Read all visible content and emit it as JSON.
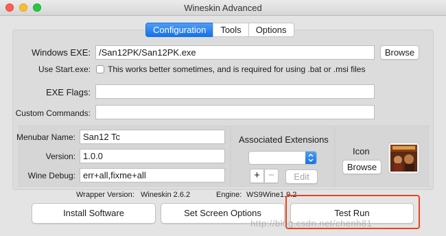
{
  "window": {
    "title": "Wineskin Advanced"
  },
  "tabs": [
    {
      "label": "Configuration",
      "active": true
    },
    {
      "label": "Tools",
      "active": false
    },
    {
      "label": "Options",
      "active": false
    }
  ],
  "config": {
    "windows_exe_label": "Windows EXE:",
    "windows_exe_value": "/San12PK/San12PK.exe",
    "browse_label": "Browse",
    "use_start_label": "Use Start.exe:",
    "use_start_checked": false,
    "use_start_desc": "This works better sometimes, and is required for using .bat or .msi files",
    "exe_flags_label": "EXE Flags:",
    "exe_flags_value": "",
    "custom_commands_label": "Custom Commands:",
    "custom_commands_value": "",
    "menubar_name_label": "Menubar Name:",
    "menubar_name_value": "San12 Tc",
    "version_label": "Version:",
    "version_value": "1.0.0",
    "wine_debug_label": "Wine Debug:",
    "wine_debug_value": "err+all,fixme+all",
    "associated_extensions_title": "Associated Extensions",
    "add_symbol": "+",
    "remove_symbol": "−",
    "edit_label": "Edit",
    "icon_label": "Icon",
    "icon_browse_label": "Browse"
  },
  "footer": {
    "wrapper_version_label": "Wrapper Version:",
    "wrapper_version_value": "Wineskin 2.6.2",
    "engine_label": "Engine:",
    "engine_value": "WS9Wine1.9.2"
  },
  "actions": {
    "install_software": "Install Software",
    "set_screen_options": "Set Screen Options",
    "test_run": "Test Run"
  },
  "watermark": "http://blog.csdn.net/chenh81",
  "colors": {
    "accent": "#1673e6",
    "highlight_border": "#e8431e",
    "close": "#fc5f57",
    "minimize": "#fdbc2e",
    "zoom": "#28c840"
  }
}
